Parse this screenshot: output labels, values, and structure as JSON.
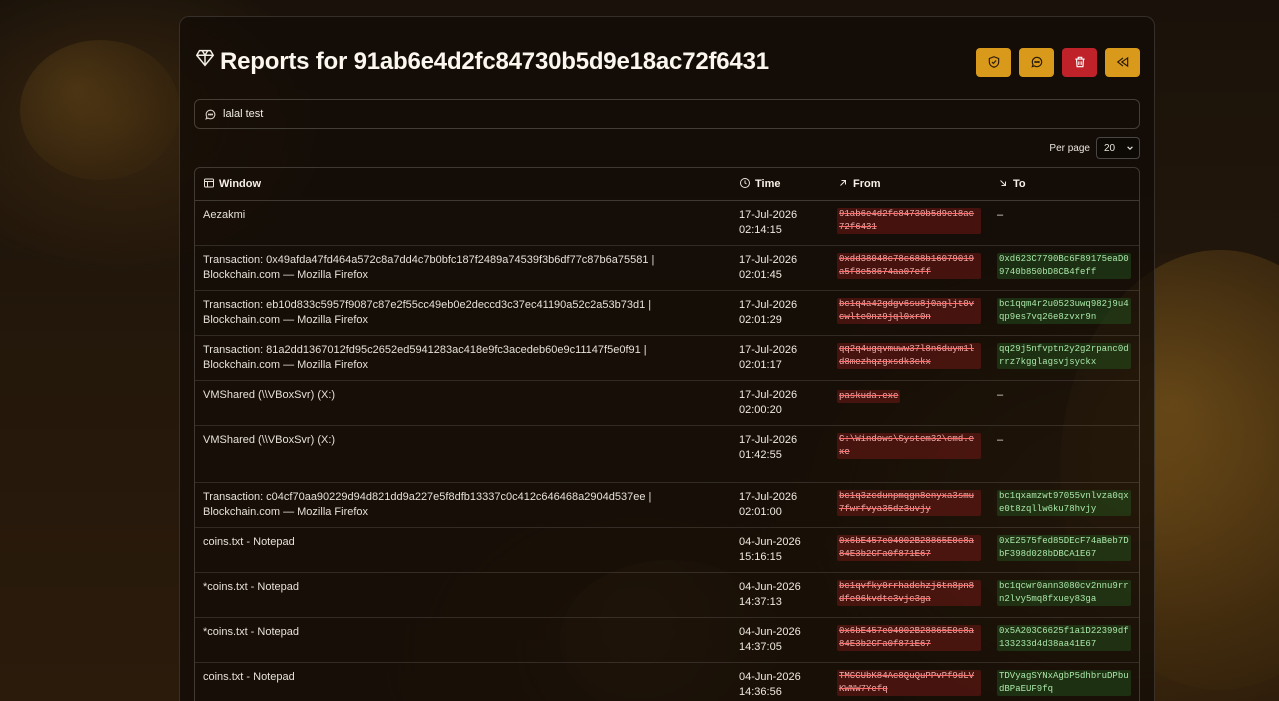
{
  "header": {
    "title": "Reports for 91ab6e4d2fc84730b5d9e18ac72f6431",
    "gem_icon": "gem-icon",
    "actions": [
      {
        "name": "shield-check-icon",
        "color": "#d99a1c"
      },
      {
        "name": "message-icon",
        "color": "#d99a1c"
      },
      {
        "name": "trash-icon",
        "color": "#c0222a"
      },
      {
        "name": "back-icon",
        "color": "#d99a1c"
      }
    ]
  },
  "comment": {
    "icon": "message-icon",
    "text": "lalal test"
  },
  "pagination": {
    "label": "Per page",
    "value": "20"
  },
  "table": {
    "columns": [
      {
        "label": "Window",
        "icon": "window-icon"
      },
      {
        "label": "Time",
        "icon": "clock-icon"
      },
      {
        "label": "From",
        "icon": "arrow-up-right-icon"
      },
      {
        "label": "To",
        "icon": "arrow-down-right-icon"
      }
    ],
    "rows": [
      {
        "window": "Aezakmi",
        "date": "17-Jul-2026",
        "time": "02:14:15",
        "from": "91ab6e4d2fc84730b5d9e18ac72f6431",
        "to": "–"
      },
      {
        "window": "Transaction: 0x49afda47fd464a572c8a7dd4c7b0bfc187f2489a74539f3b6df77c87b6a75581 | Blockchain.com — Mozilla Firefox",
        "date": "17-Jul-2026",
        "time": "02:01:45",
        "from": "0xdd38048c78c688b16079019a5f8e58674aa07eff",
        "to": "0xd623C7790Bc6F89175eaD09740b850bD8CB4feff"
      },
      {
        "window": "Transaction: eb10d833c5957f9087c87e2f55cc49eb0e2deccd3c37ec41190a52c2a53b73d1 | Blockchain.com — Mozilla Firefox",
        "date": "17-Jul-2026",
        "time": "02:01:29",
        "from": "bc1q4a42gdgv6su8j0agljt0vcwlte0nz9jql0xr0n",
        "to": "bc1qqm4r2u0523uwq982j9u4qp9es7vq26e8zvxr9n"
      },
      {
        "window": "Transaction: 81a2dd1367012fd95c2652ed5941283ac418e9fc3acedeb60e9c11147f5e0f91 | Blockchain.com — Mozilla Firefox",
        "date": "17-Jul-2026",
        "time": "02:01:17",
        "from": "qq2q4ugqvmuww37l8n6duym1ld8mezhqzgxsdk3ckx",
        "to": "qq29j5nfvptn2y2g2rpanc0drrz7kgglagsvjsyckx"
      },
      {
        "window": "VMShared (\\\\VBoxSvr) (X:)",
        "date": "17-Jul-2026",
        "time": "02:00:20",
        "from": "paskuda.exe",
        "to": "–"
      },
      {
        "window": "VMShared (\\\\VBoxSvr) (X:)",
        "date": "17-Jul-2026",
        "time": "01:42:55",
        "from": "C:\\Windows\\System32\\cmd.exe",
        "to": "–"
      },
      {
        "window": "Transaction: c04cf70aa90229d94d821dd9a227e5f8dfb13337c0c412c646468a2904d537ee | Blockchain.com — Mozilla Firefox",
        "date": "17-Jul-2026",
        "time": "02:01:00",
        "from": "bc1q3zcdunpmqgn8enyxa3smu7fwrfvya35dz3uvjy",
        "to": "bc1qxamzwt97055vnlvza0qxe0t8zqllw6ku78hvjy"
      },
      {
        "window": "coins.txt - Notepad",
        "date": "04-Jun-2026",
        "time": "15:16:15",
        "from": "0x6bE457e04002B28865E0c8a84E3b2CFa0f871E67",
        "to": "0xE2575fed85DEcF74aBeb7DbF398d028bDBCA1E67"
      },
      {
        "window": "*coins.txt - Notepad",
        "date": "04-Jun-2026",
        "time": "14:37:13",
        "from": "bc1qvfky0rrhadchzj6tn8pn8dfe06kvdtc3vjc3ga",
        "to": "bc1qcwr0ann3080cv2nnu9rrn2lvy5mq8fxuey83ga"
      },
      {
        "window": "*coins.txt - Notepad",
        "date": "04-Jun-2026",
        "time": "14:37:05",
        "from": "0x6bE457e04002B28865E0c8a84E3b2CFa0f871E67",
        "to": "0x5A203C6625f1a1D22399df133233d4d38aa41E67"
      },
      {
        "window": "coins.txt - Notepad",
        "date": "04-Jun-2026",
        "time": "14:36:56",
        "from": "TMCCUbK84Ac8QuQuPPvPf9dLVKWNW7Yefq",
        "to": "TDVyagSYNxAgbP5dhbruDPbudBPaEUF9fq"
      }
    ]
  }
}
